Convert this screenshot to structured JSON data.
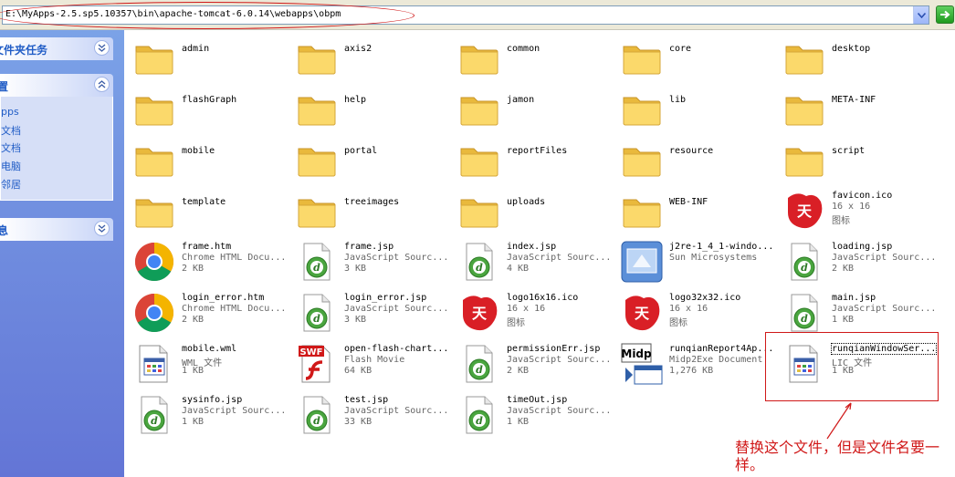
{
  "address_bar": {
    "path": "E:\\MyApps-2.5.sp5.10357\\bin\\apache-tomcat-6.0.14\\webapps\\obpm"
  },
  "sidebar": {
    "folder_tasks": {
      "title": "文件夹任务"
    },
    "other_places": {
      "title": "置",
      "items": [
        "pps",
        "文档",
        "文档",
        "电脑",
        "邻居"
      ]
    },
    "details": {
      "title": "息"
    }
  },
  "files": [
    {
      "name": "admin",
      "kind": "folder"
    },
    {
      "name": "axis2",
      "kind": "folder"
    },
    {
      "name": "common",
      "kind": "folder"
    },
    {
      "name": "core",
      "kind": "folder"
    },
    {
      "name": "desktop",
      "kind": "folder"
    },
    {
      "name": "flashGraph",
      "kind": "folder"
    },
    {
      "name": "help",
      "kind": "folder"
    },
    {
      "name": "jamon",
      "kind": "folder"
    },
    {
      "name": "lib",
      "kind": "folder"
    },
    {
      "name": "META-INF",
      "kind": "folder"
    },
    {
      "name": "mobile",
      "kind": "folder"
    },
    {
      "name": "portal",
      "kind": "folder"
    },
    {
      "name": "reportFiles",
      "kind": "folder"
    },
    {
      "name": "resource",
      "kind": "folder"
    },
    {
      "name": "script",
      "kind": "folder"
    },
    {
      "name": "template",
      "kind": "folder"
    },
    {
      "name": "treeimages",
      "kind": "folder"
    },
    {
      "name": "uploads",
      "kind": "folder"
    },
    {
      "name": "WEB-INF",
      "kind": "folder"
    },
    {
      "name": "favicon.ico",
      "kind": "ico",
      "desc": "16 x 16",
      "size": "图标"
    },
    {
      "name": "frame.htm",
      "kind": "chrome",
      "desc": "Chrome HTML Docu...",
      "size": "2 KB"
    },
    {
      "name": "frame.jsp",
      "kind": "jsp",
      "desc": "JavaScript Sourc...",
      "size": "3 KB"
    },
    {
      "name": "index.jsp",
      "kind": "jsp",
      "desc": "JavaScript Sourc...",
      "size": "4 KB"
    },
    {
      "name": "j2re-1_4_1-windo...",
      "kind": "installer",
      "desc": "Sun Microsystems",
      "size": ""
    },
    {
      "name": "loading.jsp",
      "kind": "jsp",
      "desc": "JavaScript Sourc...",
      "size": "2 KB"
    },
    {
      "name": "login_error.htm",
      "kind": "chrome",
      "desc": "Chrome HTML Docu...",
      "size": "2 KB"
    },
    {
      "name": "login_error.jsp",
      "kind": "jsp",
      "desc": "JavaScript Sourc...",
      "size": "3 KB"
    },
    {
      "name": "logo16x16.ico",
      "kind": "ico",
      "desc": "16 x 16",
      "size": "图标"
    },
    {
      "name": "logo32x32.ico",
      "kind": "ico",
      "desc": "16 x 16",
      "size": "图标"
    },
    {
      "name": "main.jsp",
      "kind": "jsp",
      "desc": "JavaScript Sourc...",
      "size": "1 KB"
    },
    {
      "name": "mobile.wml",
      "kind": "doc",
      "desc": "WML 文件",
      "size": "1 KB"
    },
    {
      "name": "open-flash-chart...",
      "kind": "swf",
      "desc": "Flash Movie",
      "size": "64 KB",
      "badge": "SWF"
    },
    {
      "name": "permissionErr.jsp",
      "kind": "jsp",
      "desc": "JavaScript Sourc...",
      "size": "2 KB"
    },
    {
      "name": "runqianReport4Ap...",
      "kind": "midp",
      "desc": "Midp2Exe Document",
      "size": "1,276 KB",
      "badge": "Midp"
    },
    {
      "name": "runqianWindowSer...",
      "kind": "doc",
      "desc": "LIC 文件",
      "size": "1 KB",
      "selected": true
    },
    {
      "name": "sysinfo.jsp",
      "kind": "jsp",
      "desc": "JavaScript Sourc...",
      "size": "1 KB"
    },
    {
      "name": "test.jsp",
      "kind": "jsp",
      "desc": "JavaScript Sourc...",
      "size": "33 KB"
    },
    {
      "name": "timeOut.jsp",
      "kind": "jsp",
      "desc": "JavaScript Sourc...",
      "size": "1 KB"
    }
  ],
  "annotation": {
    "text": "替换这个文件，但是文件名要一样。"
  },
  "colors": {
    "annotation": "#d01818",
    "sidebar_blue": "#6375d6",
    "link_blue": "#215dc6",
    "folder_yellow": "#f7d66b"
  }
}
